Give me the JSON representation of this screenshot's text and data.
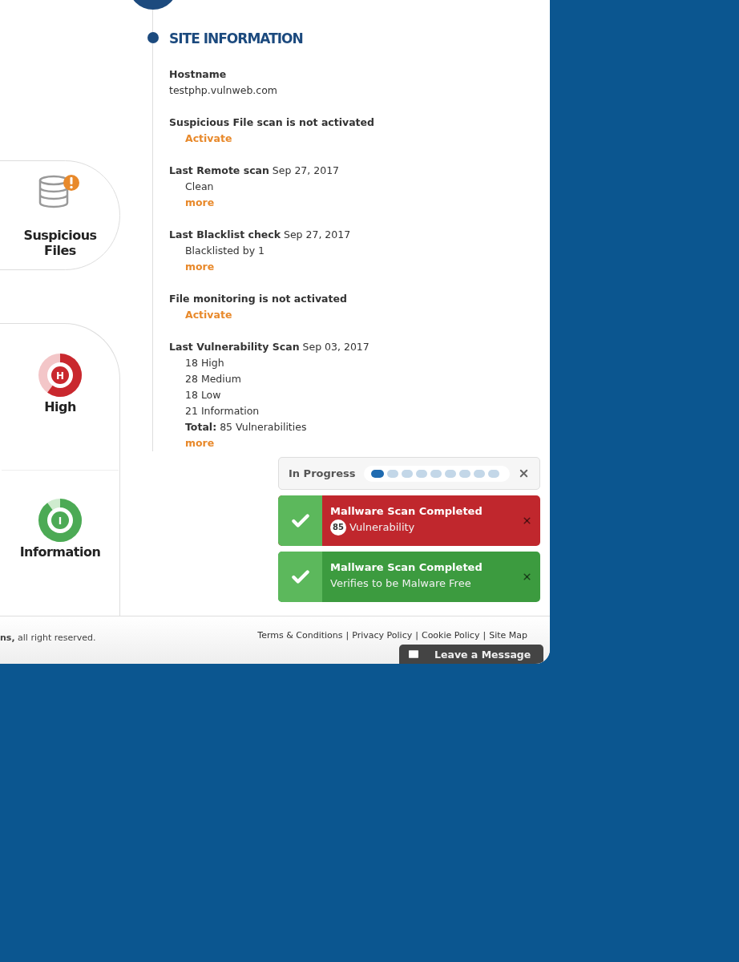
{
  "side_cards": [
    {
      "kind": "files",
      "label": "Suspicious Files"
    },
    {
      "kind": "severity",
      "items": [
        {
          "kind": "high",
          "letter": "H",
          "label": "High"
        },
        {
          "kind": "info",
          "letter": "I",
          "label": "Information"
        }
      ]
    }
  ],
  "site_info": {
    "title": "SITE INFORMATION",
    "items": [
      {
        "label": "Hostname",
        "lines": [
          {
            "kind": "plain",
            "text": "testphp.vulnweb.com"
          }
        ]
      },
      {
        "label": "Suspicious File scan is not activated",
        "lines": [
          {
            "kind": "link",
            "text": "Activate"
          }
        ]
      },
      {
        "label": "Last Remote scan",
        "value": "Sep 27, 2017",
        "lines": [
          {
            "kind": "text",
            "text": "Clean"
          },
          {
            "kind": "link",
            "text": "more"
          }
        ]
      },
      {
        "label": "Last Blacklist check",
        "value": "Sep 27, 2017",
        "lines": [
          {
            "kind": "text",
            "text": "Blacklisted by 1"
          },
          {
            "kind": "link",
            "text": "more"
          }
        ]
      },
      {
        "label": "File monitoring is not activated",
        "lines": [
          {
            "kind": "link",
            "text": "Activate"
          }
        ]
      },
      {
        "label": "Last Vulnerability Scan",
        "value": "Sep 03, 2017",
        "lines": [
          {
            "kind": "text",
            "text": "18 High"
          },
          {
            "kind": "text",
            "text": "28 Medium"
          },
          {
            "kind": "text",
            "text": "18 Low"
          },
          {
            "kind": "text",
            "text": "21 Information"
          },
          {
            "kind": "text",
            "text": "**Total:** 85 Vulnerabilities"
          },
          {
            "kind": "link",
            "text": "more"
          }
        ]
      }
    ]
  },
  "progress": {
    "label": "In Progress",
    "steps": [
      {
        "done": true
      },
      {
        "done": false
      },
      {
        "done": false
      },
      {
        "done": false
      },
      {
        "done": false
      },
      {
        "done": false
      },
      {
        "done": false
      },
      {
        "done": false
      },
      {
        "done": false
      }
    ]
  },
  "notifications": [
    {
      "kind": "error",
      "title": "Mallware Scan Completed",
      "badge": "85",
      "text": "Vulnerability"
    },
    {
      "kind": "success",
      "title": "Mallware Scan Completed",
      "text": "Verifies to be Malware Free"
    }
  ],
  "footer": {
    "copyright": "**ns,** all right reserved.",
    "links": [
      "Terms & Conditions",
      "Privacy Policy",
      "Cookie Policy",
      "Site Map"
    ],
    "separator": "|"
  },
  "chat_button": {
    "label": "Leave a Message"
  }
}
